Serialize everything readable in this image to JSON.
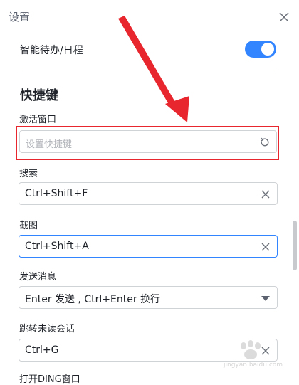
{
  "window": {
    "title": "设置"
  },
  "toggle_row": {
    "label": "智能待办/日程",
    "enabled": true
  },
  "section": {
    "title": "快捷键"
  },
  "shortcuts": [
    {
      "label": "激活窗口",
      "value": "",
      "placeholder": "设置快捷键",
      "icon": "reset-icon",
      "focused": false
    },
    {
      "label": "搜索",
      "value": "Ctrl+Shift+F",
      "placeholder": "",
      "icon": "clear-icon",
      "focused": false
    },
    {
      "label": "截图",
      "value": "Ctrl+Shift+A",
      "placeholder": "",
      "icon": "clear-icon",
      "focused": true
    },
    {
      "label": "发送消息",
      "value": "Enter 发送 , Ctrl+Enter 换行",
      "placeholder": "",
      "icon": "dropdown-arrow-icon",
      "focused": false
    },
    {
      "label": "跳转未读会话",
      "value": "Ctrl+G",
      "placeholder": "",
      "icon": "clear-icon",
      "focused": false
    },
    {
      "label": "打开DING窗口"
    }
  ],
  "watermark": {
    "text": "jingyan.baidu.com"
  },
  "colors": {
    "accent": "#3385ff",
    "annotation": "#e8262d",
    "border": "#d0d3d6"
  }
}
